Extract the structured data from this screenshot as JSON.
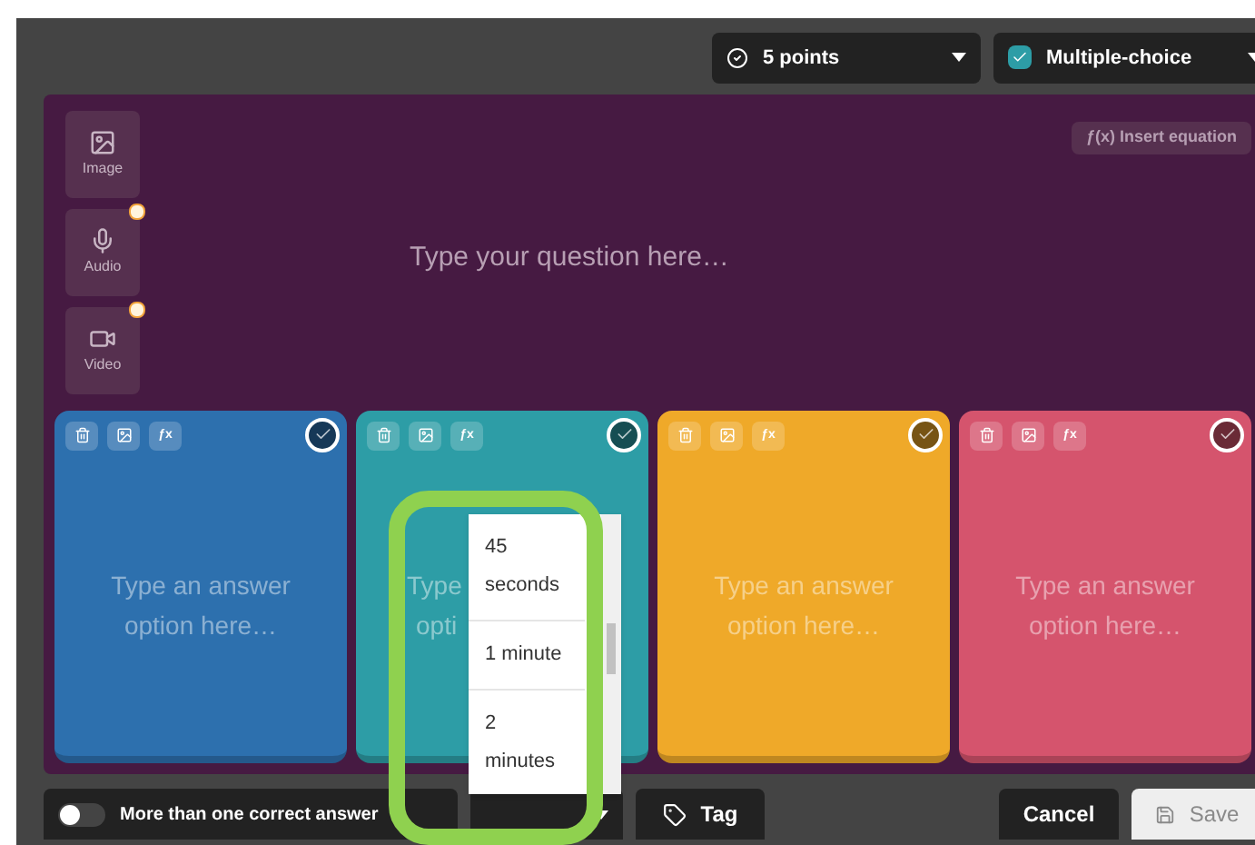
{
  "top_bar": {
    "points": {
      "label": "5 points"
    },
    "question_type": {
      "label": "Multiple-choice"
    }
  },
  "question": {
    "placeholder": "Type your question here…",
    "insert_equation": "Insert equation",
    "insert_equation_icon": "ƒ(x)",
    "media": [
      {
        "label": "Image",
        "kind": "image",
        "premium": false
      },
      {
        "label": "Audio",
        "kind": "audio",
        "premium": true
      },
      {
        "label": "Video",
        "kind": "video",
        "premium": true
      }
    ]
  },
  "answers": [
    {
      "placeholder": [
        "Type an answer",
        "option here…"
      ],
      "kind": "full",
      "equation_label": "ƒx",
      "color": "#2d70ae",
      "correct": false
    },
    {
      "placeholder": [
        "Type",
        "opti"
      ],
      "kind": "covered",
      "equation_label": "ƒx",
      "color": "#2d9da6",
      "correct": false
    },
    {
      "placeholder": [
        "Type an answer",
        "option here…"
      ],
      "kind": "full",
      "equation_label": "ƒx",
      "color": "#efa929",
      "correct": false
    },
    {
      "placeholder": [
        "Type an answer",
        "option here…"
      ],
      "kind": "full",
      "equation_label": "ƒx",
      "color": "#d5546d",
      "correct": false
    }
  ],
  "time_menu": {
    "options": [
      {
        "label": "45 seconds"
      },
      {
        "label": "1 minute"
      },
      {
        "label": "2 minutes"
      }
    ]
  },
  "bottom_bar": {
    "multiple_correct": {
      "label": "More than one correct answer",
      "on": false
    },
    "tag": "Tag",
    "cancel": "Cancel",
    "save": {
      "label": "Save",
      "disabled": true
    }
  }
}
